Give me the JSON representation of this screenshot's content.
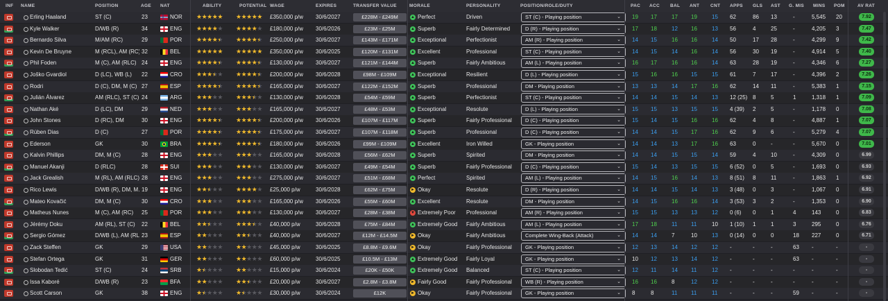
{
  "headers": {
    "inf": "INF",
    "name": "NAME",
    "position": "POSITION",
    "age": "AGE",
    "nat": "NAT",
    "ability": "ABILITY",
    "potential": "POTENTIAL",
    "wage": "WAGE",
    "expires": "EXPIRES",
    "transfer_value": "TRANSFER VALUE",
    "morale": "MORALE",
    "personality": "PERSONALITY",
    "role": "POSITION/ROLE/DUTY",
    "pac": "PAC",
    "acc": "ACC",
    "bal": "BAL",
    "ant": "ANT",
    "cnt": "CNT",
    "apps": "APPS",
    "gls": "GLS",
    "ast": "AST",
    "gmis": "G. MIS",
    "mins": "MINS",
    "pom": "POM",
    "avrat": "AV RAT"
  },
  "colors": {
    "attr_high": "#4fd14f",
    "attr_mid": "#3b9ff0",
    "attr_low": "#e6e6e6",
    "mood_good": "#3fc25a",
    "mood_okay": "#f0b92c",
    "mood_bad": "#e0483d",
    "rating_green": "#3fb84a",
    "rating_grey": "#3a3a40"
  },
  "players": [
    {
      "name": "Erling Haaland",
      "position": "ST (C)",
      "age": "23",
      "flag": "nor",
      "nat": "NOR",
      "ability": 5,
      "potential": 5,
      "wage": "£350,000 p/w",
      "expires": "30/6/2027",
      "tv": "£228M - £249M",
      "mood": "good",
      "morale": "Perfect",
      "personality": "Driven",
      "role": "ST (C) - Playing position",
      "pac": "19",
      "acc": "17",
      "bal": "17",
      "ant": "19",
      "cnt": "15",
      "apps": "62",
      "gls": "86",
      "ast": "13",
      "gmis": "-",
      "mins": "5,545",
      "pom": "20",
      "avrat": "7.92",
      "rat": "green"
    },
    {
      "name": "Kyle Walker",
      "position": "D/WB (R)",
      "age": "34",
      "flag": "eng",
      "nat": "ENG",
      "ability": 4,
      "potential": 4,
      "wage": "£180,000 p/w",
      "expires": "30/6/2026",
      "tv": "£23M - £25M",
      "mood": "good",
      "morale": "Superb",
      "personality": "Fairly Determined",
      "role": "D (R) - Playing position",
      "pac": "17",
      "acc": "18",
      "bal": "12",
      "ant": "16",
      "cnt": "13",
      "apps": "56",
      "gls": "4",
      "ast": "25",
      "gmis": "-",
      "mins": "4,205",
      "pom": "3",
      "avrat": "7.47",
      "rat": "green"
    },
    {
      "name": "Bernardo Silva",
      "position": "M/AM (RC)",
      "age": "29",
      "flag": "por",
      "nat": "POR",
      "ability": 4.5,
      "potential": 4.5,
      "wage": "£250,000 p/w",
      "expires": "30/6/2027",
      "tv": "£143M - £171M",
      "mood": "good",
      "morale": "Exceptional",
      "personality": "Perfectionist",
      "role": "AM (R) - Playing position",
      "pac": "14",
      "acc": "15",
      "bal": "16",
      "ant": "16",
      "cnt": "14",
      "apps": "50",
      "gls": "17",
      "ast": "28",
      "gmis": "-",
      "mins": "4,299",
      "pom": "9",
      "avrat": "7.42",
      "rat": "green"
    },
    {
      "name": "Kevin De Bruyne",
      "position": "M (RCL), AM (RC),...",
      "age": "32",
      "flag": "bel",
      "nat": "BEL",
      "ability": 5,
      "potential": 5,
      "wage": "£350,000 p/w",
      "expires": "30/6/2025",
      "tv": "£120M - £131M",
      "mood": "good",
      "morale": "Excellent",
      "personality": "Professional",
      "role": "ST (C) - Playing position",
      "pac": "14",
      "acc": "15",
      "bal": "14",
      "ant": "16",
      "cnt": "14",
      "apps": "56",
      "gls": "30",
      "ast": "19",
      "gmis": "-",
      "mins": "4,914",
      "pom": "5",
      "avrat": "7.40",
      "rat": "green"
    },
    {
      "name": "Phil Foden",
      "position": "M (C), AM (RLC)",
      "age": "24",
      "flag": "eng",
      "nat": "ENG",
      "ability": 4.5,
      "potential": 4.5,
      "wage": "£130,000 p/w",
      "expires": "30/6/2027",
      "tv": "£121M - £144M",
      "mood": "good",
      "morale": "Superb",
      "personality": "Fairly Ambitious",
      "role": "AM (L) - Playing position",
      "pac": "16",
      "acc": "17",
      "bal": "16",
      "ant": "16",
      "cnt": "14",
      "apps": "63",
      "gls": "28",
      "ast": "19",
      "gmis": "-",
      "mins": "4,346",
      "pom": "6",
      "avrat": "7.27",
      "rat": "green"
    },
    {
      "name": "Joško Gvardiol",
      "position": "D (LC), WB (L)",
      "age": "22",
      "flag": "cro",
      "nat": "CRO",
      "ability": 3.5,
      "potential": 4.5,
      "wage": "£200,000 p/w",
      "expires": "30/6/2028",
      "tv": "£98M - £109M",
      "mood": "good",
      "morale": "Exceptional",
      "personality": "Resilient",
      "role": "D (L) - Playing position",
      "pac": "15",
      "acc": "16",
      "bal": "16",
      "ant": "15",
      "cnt": "15",
      "apps": "61",
      "gls": "7",
      "ast": "17",
      "gmis": "-",
      "mins": "4,396",
      "pom": "2",
      "avrat": "7.26",
      "rat": "green"
    },
    {
      "name": "Rodri",
      "position": "D (C), DM, M (C)",
      "age": "27",
      "flag": "esp",
      "nat": "ESP",
      "ability": 4.5,
      "potential": 4.5,
      "wage": "£165,000 p/w",
      "expires": "30/6/2027",
      "tv": "£122M - £152M",
      "mood": "good",
      "morale": "Superb",
      "personality": "Professional",
      "role": "DM - Playing position",
      "pac": "13",
      "acc": "13",
      "bal": "14",
      "ant": "17",
      "cnt": "16",
      "apps": "62",
      "gls": "14",
      "ast": "11",
      "gmis": "-",
      "mins": "5,383",
      "pom": "1",
      "avrat": "7.15",
      "rat": "green"
    },
    {
      "name": "Julián Álvarez",
      "position": "AM (RLC), ST (C)",
      "age": "24",
      "flag": "arg",
      "nat": "ARG",
      "ability": 3,
      "potential": 3.5,
      "wage": "£130,000 p/w",
      "expires": "30/6/2028",
      "tv": "£54M - £59M",
      "mood": "good",
      "morale": "Superb",
      "personality": "Perfectionist",
      "role": "ST (C) - Playing position",
      "pac": "14",
      "acc": "14",
      "bal": "15",
      "ant": "14",
      "cnt": "13",
      "apps": "12 (25)",
      "gls": "8",
      "ast": "5",
      "gmis": "1",
      "mins": "1,318",
      "pom": "1",
      "avrat": "7.09",
      "rat": "green"
    },
    {
      "name": "Nathan Aké",
      "position": "D (LC), DM",
      "age": "29",
      "flag": "ned",
      "nat": "NED",
      "ability": 3,
      "potential": 3,
      "wage": "£165,000 p/w",
      "expires": "30/6/2027",
      "tv": "£48M - £53M",
      "mood": "good",
      "morale": "Exceptional",
      "personality": "Resolute",
      "role": "D (L) - Playing position",
      "pac": "15",
      "acc": "15",
      "bal": "13",
      "ant": "15",
      "cnt": "15",
      "apps": "4 (39)",
      "gls": "2",
      "ast": "5",
      "gmis": "-",
      "mins": "1,178",
      "pom": "0",
      "avrat": "7.08",
      "rat": "green"
    },
    {
      "name": "John Stones",
      "position": "D (RC), DM",
      "age": "30",
      "flag": "eng",
      "nat": "ENG",
      "ability": 4.5,
      "potential": 4.5,
      "wage": "£200,000 p/w",
      "expires": "30/6/2026",
      "tv": "£107M - £117M",
      "mood": "good",
      "morale": "Superb",
      "personality": "Fairly Professional",
      "role": "D (C) - Playing position",
      "pac": "15",
      "acc": "14",
      "bal": "15",
      "ant": "16",
      "cnt": "16",
      "apps": "62",
      "gls": "4",
      "ast": "8",
      "gmis": "-",
      "mins": "4,887",
      "pom": "1",
      "avrat": "7.07",
      "rat": "green"
    },
    {
      "name": "Rúben Dias",
      "position": "D (C)",
      "age": "27",
      "flag": "por",
      "nat": "POR",
      "ability": 4.5,
      "potential": 4.5,
      "wage": "£175,000 p/w",
      "expires": "30/6/2027",
      "tv": "£107M - £118M",
      "mood": "good",
      "morale": "Superb",
      "personality": "Professional",
      "role": "D (C) - Playing position",
      "pac": "14",
      "acc": "14",
      "bal": "15",
      "ant": "17",
      "cnt": "16",
      "apps": "62",
      "gls": "9",
      "ast": "6",
      "gmis": "-",
      "mins": "5,279",
      "pom": "4",
      "avrat": "7.07",
      "rat": "green"
    },
    {
      "name": "Ederson",
      "position": "GK",
      "age": "30",
      "flag": "bra",
      "nat": "BRA",
      "ability": 4.5,
      "potential": 4.5,
      "wage": "£180,000 p/w",
      "expires": "30/6/2026",
      "tv": "£99M - £109M",
      "mood": "good",
      "morale": "Excellent",
      "personality": "Iron Willed",
      "role": "GK - Playing position",
      "pac": "14",
      "acc": "14",
      "bal": "13",
      "ant": "17",
      "cnt": "16",
      "apps": "63",
      "gls": "0",
      "ast": "-",
      "gmis": "-",
      "mins": "5,670",
      "pom": "0",
      "avrat": "7.01",
      "rat": "green"
    },
    {
      "name": "Kalvin Phillips",
      "position": "DM, M (C)",
      "age": "28",
      "flag": "eng",
      "nat": "ENG",
      "ability": 3,
      "potential": 3,
      "wage": "£165,000 p/w",
      "expires": "30/6/2028",
      "tv": "£56M - £62M",
      "mood": "good",
      "morale": "Superb",
      "personality": "Spirited",
      "role": "DM - Playing position",
      "pac": "14",
      "acc": "14",
      "bal": "15",
      "ant": "15",
      "cnt": "14",
      "apps": "59",
      "gls": "4",
      "ast": "10",
      "gmis": "-",
      "mins": "4,309",
      "pom": "0",
      "avrat": "6.99",
      "rat": "grey"
    },
    {
      "name": "Manuel Akanji",
      "position": "D (RLC)",
      "age": "28",
      "flag": "sui",
      "nat": "SUI",
      "ability": 3,
      "potential": 3,
      "wage": "£130,000 p/w",
      "expires": "30/6/2027",
      "tv": "£49M - £54M",
      "mood": "good",
      "morale": "Superb",
      "personality": "Fairly Professional",
      "role": "D (C) - Playing position",
      "pac": "15",
      "acc": "14",
      "bal": "13",
      "ant": "15",
      "cnt": "15",
      "apps": "6 (52)",
      "gls": "0",
      "ast": "5",
      "gmis": "-",
      "mins": "1,693",
      "pom": "0",
      "avrat": "6.93",
      "rat": "grey"
    },
    {
      "name": "Jack Grealish",
      "position": "M (RL), AM (RLC)",
      "age": "28",
      "flag": "eng",
      "nat": "ENG",
      "ability": 3,
      "potential": 3,
      "wage": "£275,000 p/w",
      "expires": "30/6/2027",
      "tv": "£51M - £68M",
      "mood": "good",
      "morale": "Perfect",
      "personality": "Spirited",
      "role": "AM (L) - Playing position",
      "pac": "14",
      "acc": "15",
      "bal": "16",
      "ant": "14",
      "cnt": "13",
      "apps": "8 (51)",
      "gls": "8",
      "ast": "11",
      "gmis": "-",
      "mins": "1,863",
      "pom": "1",
      "avrat": "6.92",
      "rat": "grey"
    },
    {
      "name": "Rico Lewis",
      "position": "D/WB (R), DM, M...",
      "age": "19",
      "flag": "eng",
      "nat": "ENG",
      "ability": 2.5,
      "potential": 4,
      "wage": "£25,000 p/w",
      "expires": "30/6/2028",
      "tv": "£62M - £75M",
      "mood": "okay",
      "morale": "Okay",
      "personality": "Resolute",
      "role": "D (R) - Playing position",
      "pac": "14",
      "acc": "14",
      "bal": "15",
      "ant": "14",
      "cnt": "13",
      "apps": "3 (48)",
      "gls": "0",
      "ast": "3",
      "gmis": "-",
      "mins": "1,067",
      "pom": "0",
      "avrat": "6.91",
      "rat": "grey"
    },
    {
      "name": "Mateo Kovačić",
      "position": "DM, M (C)",
      "age": "30",
      "flag": "cro",
      "nat": "CRO",
      "ability": 3,
      "potential": 3,
      "wage": "£165,000 p/w",
      "expires": "30/6/2026",
      "tv": "£55M - £60M",
      "mood": "good",
      "morale": "Excellent",
      "personality": "Resolute",
      "role": "DM - Playing position",
      "pac": "14",
      "acc": "15",
      "bal": "16",
      "ant": "16",
      "cnt": "14",
      "apps": "3 (53)",
      "gls": "3",
      "ast": "2",
      "gmis": "-",
      "mins": "1,353",
      "pom": "0",
      "avrat": "6.90",
      "rat": "grey"
    },
    {
      "name": "Matheus Nunes",
      "position": "M (C), AM (RC)",
      "age": "25",
      "flag": "por",
      "nat": "POR",
      "ability": 3,
      "potential": 3,
      "wage": "£130,000 p/w",
      "expires": "30/6/2027",
      "tv": "£28M - £38M",
      "mood": "bad",
      "morale": "Extremely Poor",
      "personality": "Professional",
      "role": "AM (R) - Playing position",
      "pac": "15",
      "acc": "15",
      "bal": "13",
      "ant": "13",
      "cnt": "12",
      "apps": "0 (6)",
      "gls": "0",
      "ast": "1",
      "gmis": "4",
      "mins": "143",
      "pom": "0",
      "avrat": "6.83",
      "rat": "grey"
    },
    {
      "name": "Jérémy Doku",
      "position": "AM (RL), ST (C)",
      "age": "22",
      "flag": "bel",
      "nat": "BEL",
      "ability": 2.5,
      "potential": 3.5,
      "wage": "£40,000 p/w",
      "expires": "30/6/2028",
      "tv": "£75M - £84M",
      "mood": "good",
      "morale": "Extremely Good",
      "personality": "Fairly Ambitious",
      "role": "AM (L) - Playing position",
      "pac": "17",
      "acc": "18",
      "bal": "11",
      "ant": "11",
      "cnt": "10",
      "apps": "1 (10)",
      "gls": "1",
      "ast": "1",
      "gmis": "3",
      "mins": "295",
      "pom": "0",
      "avrat": "6.76",
      "rat": "grey"
    },
    {
      "name": "Sergio Gómez",
      "position": "D/WB (L), AM (RL)",
      "age": "23",
      "flag": "esp",
      "nat": "ESP",
      "ability": 2,
      "potential": 2.5,
      "wage": "£40,000 p/w",
      "expires": "30/6/2027",
      "tv": "£12M - £14.5M",
      "mood": "okay",
      "morale": "Okay",
      "personality": "Fairly Ambitious",
      "role": "Complete Wing-Back (Attack)",
      "pac": "14",
      "acc": "14",
      "bal": "7",
      "ant": "10",
      "cnt": "13",
      "apps": "0 (14)",
      "gls": "0",
      "ast": "0",
      "gmis": "18",
      "mins": "227",
      "pom": "0",
      "avrat": "6.71",
      "rat": "grey"
    },
    {
      "name": "Zack Steffen",
      "position": "GK",
      "age": "29",
      "flag": "usa",
      "nat": "USA",
      "ability": 2,
      "potential": 2,
      "wage": "£45,000 p/w",
      "expires": "30/6/2025",
      "tv": "£8.8M - £9.6M",
      "mood": "okay",
      "morale": "Okay",
      "personality": "Fairly Professional",
      "role": "GK - Playing position",
      "pac": "12",
      "acc": "13",
      "bal": "14",
      "ant": "12",
      "cnt": "12",
      "apps": "-",
      "gls": "-",
      "ast": "-",
      "gmis": "63",
      "mins": "-",
      "pom": "-",
      "avrat": "-",
      "rat": "grey"
    },
    {
      "name": "Stefan Ortega",
      "position": "GK",
      "age": "31",
      "flag": "ger",
      "nat": "GER",
      "ability": 2,
      "potential": 2,
      "wage": "£60,000 p/w",
      "expires": "30/6/2025",
      "tv": "£10.5M - £13M",
      "mood": "good",
      "morale": "Extremely Good",
      "personality": "Fairly Loyal",
      "role": "GK - Playing position",
      "pac": "10",
      "acc": "12",
      "bal": "13",
      "ant": "14",
      "cnt": "12",
      "apps": "-",
      "gls": "-",
      "ast": "-",
      "gmis": "63",
      "mins": "-",
      "pom": "-",
      "avrat": "-",
      "rat": "grey"
    },
    {
      "name": "Slobodan Tedić",
      "position": "ST (C)",
      "age": "24",
      "flag": "srb",
      "nat": "SRB",
      "ability": 1.5,
      "potential": 2,
      "wage": "£15,000 p/w",
      "expires": "30/6/2024",
      "tv": "£20K - £50K",
      "mood": "good",
      "morale": "Extremely Good",
      "personality": "Balanced",
      "role": "ST (C) - Playing position",
      "pac": "12",
      "acc": "11",
      "bal": "14",
      "ant": "11",
      "cnt": "12",
      "apps": "-",
      "gls": "-",
      "ast": "-",
      "gmis": "-",
      "mins": "-",
      "pom": "-",
      "avrat": "-",
      "rat": "grey"
    },
    {
      "name": "Issa Kaboré",
      "position": "D/WB (R)",
      "age": "23",
      "flag": "bfa",
      "nat": "BFA",
      "ability": 2,
      "potential": 2.5,
      "wage": "£20,000 p/w",
      "expires": "30/6/2027",
      "tv": "£2.8M - £3.8M",
      "mood": "okay",
      "morale": "Fairly Good",
      "personality": "Fairly Professional",
      "role": "WB (R) - Playing position",
      "pac": "16",
      "acc": "16",
      "bal": "8",
      "ant": "12",
      "cnt": "12",
      "apps": "-",
      "gls": "-",
      "ast": "-",
      "gmis": "-",
      "mins": "-",
      "pom": "-",
      "avrat": "-",
      "rat": "grey"
    },
    {
      "name": "Scott Carson",
      "position": "GK",
      "age": "38",
      "flag": "eng",
      "nat": "ENG",
      "ability": 1.5,
      "potential": 1.5,
      "wage": "£30,000 p/w",
      "expires": "30/6/2024",
      "tv": "£12K",
      "mood": "okay",
      "morale": "Okay",
      "personality": "Fairly Professional",
      "role": "GK - Playing position",
      "pac": "8",
      "acc": "8",
      "bal": "11",
      "ant": "11",
      "cnt": "11",
      "apps": "-",
      "gls": "-",
      "ast": "-",
      "gmis": "59",
      "mins": "-",
      "pom": "-",
      "avrat": "-",
      "rat": "grey"
    }
  ]
}
